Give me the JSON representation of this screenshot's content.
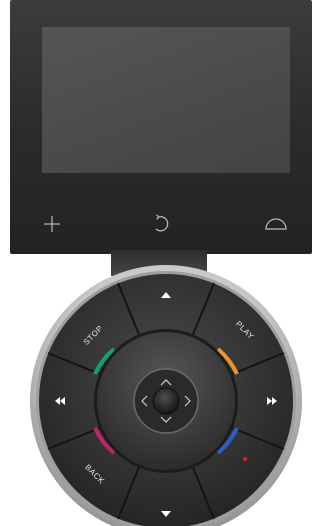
{
  "remote": {
    "screen": {
      "soft_keys": [
        {
          "name": "plus",
          "icon": "plus-icon"
        },
        {
          "name": "rotate",
          "icon": "rotate-icon"
        },
        {
          "name": "home",
          "icon": "dome-icon"
        }
      ]
    },
    "wheel": {
      "labels": {
        "stop": "STOP",
        "play": "PLAY",
        "back": "BACK"
      },
      "colors": {
        "green": "#1aa06a",
        "orange": "#f2922a",
        "red": "#c4236b",
        "blue": "#2a5fc8",
        "indicator": "#d41e1e",
        "body": "#2e2e2e",
        "rim": "#bdbdbd"
      },
      "icons": {
        "up": "triangle-up-icon",
        "down": "triangle-down-icon",
        "rewind": "rewind-icon",
        "fast_forward": "fast-forward-icon",
        "center": "center-button",
        "dpad": "chevron-icons"
      }
    }
  }
}
